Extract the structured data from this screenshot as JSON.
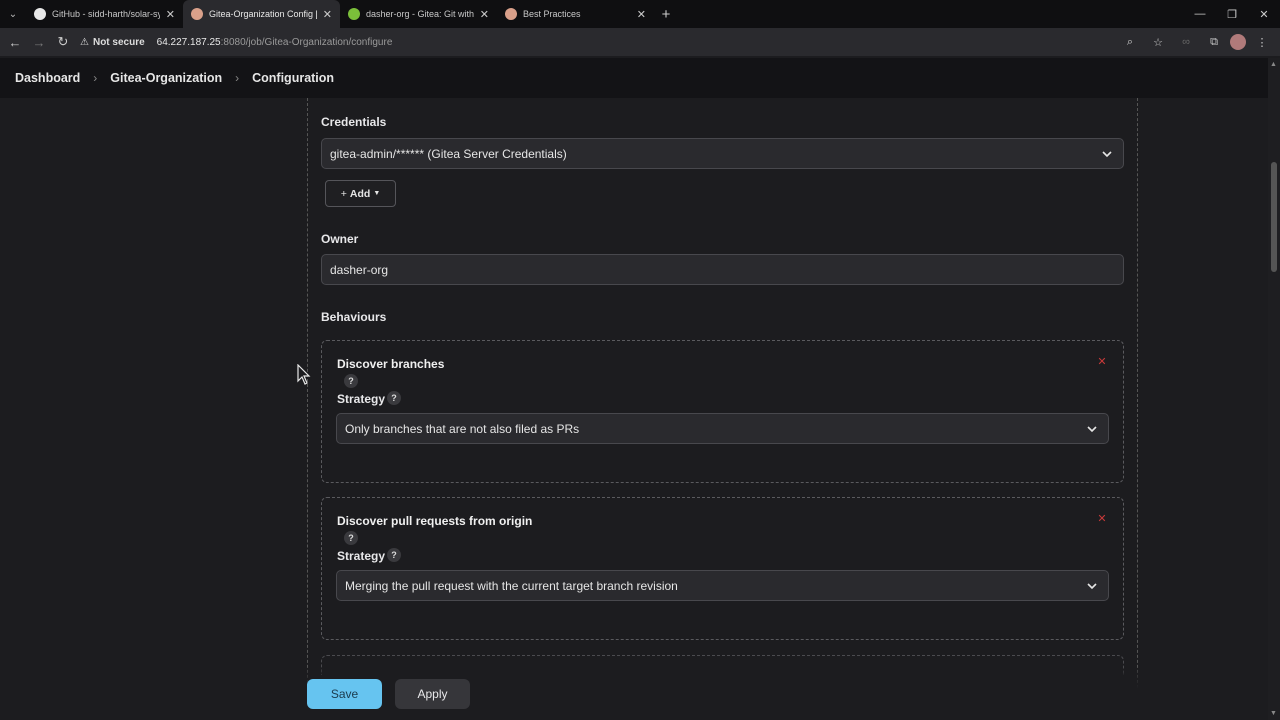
{
  "browser": {
    "tabs": [
      {
        "title": "GitHub - sidd-harth/solar-syste",
        "favicon_color": "#e8e8e8",
        "active": false
      },
      {
        "title": "Gitea-Organization Config [Jenk",
        "favicon_color": "#d9a08a",
        "active": true
      },
      {
        "title": "dasher-org - Gitea: Git with a c",
        "favicon_color": "#7bbf3a",
        "active": false
      },
      {
        "title": "Best Practices",
        "favicon_color": "#d9a08a",
        "active": false
      }
    ],
    "new_tab_glyph": "+",
    "security_label": "Not secure",
    "url_host": "64.227.187.25",
    "url_path": ":8080/job/Gitea-Organization/configure"
  },
  "header": {
    "breadcrumbs": [
      "Dashboard",
      "Gitea-Organization",
      "Configuration"
    ]
  },
  "form": {
    "credentials_label": "Credentials",
    "credentials_value": "gitea-admin/****** (Gitea Server Credentials)",
    "add_label": "Add",
    "owner_label": "Owner",
    "owner_value": "dasher-org",
    "behaviours_label": "Behaviours",
    "behaviours": [
      {
        "title": "Discover branches",
        "strategy_label": "Strategy",
        "strategy_value": "Only branches that are not also filed as PRs"
      },
      {
        "title": "Discover pull requests from origin",
        "strategy_label": "Strategy",
        "strategy_value": "Merging the pull request with the current target branch revision"
      }
    ],
    "help_glyph": "?",
    "delete_glyph": "✕"
  },
  "actions": {
    "save_label": "Save",
    "apply_label": "Apply"
  },
  "colors": {
    "save_button": "#66c4f0",
    "delete_icon": "#c83a3a"
  }
}
